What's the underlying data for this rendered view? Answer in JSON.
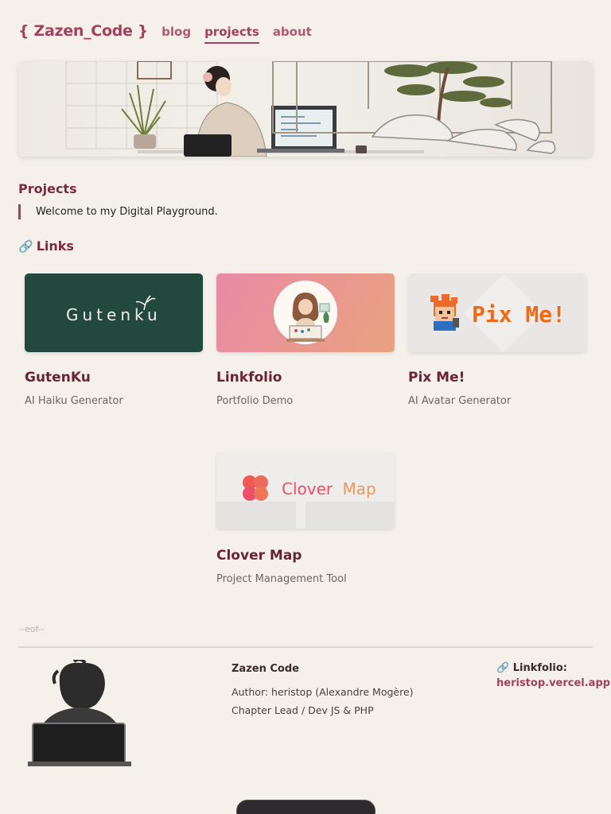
{
  "nav": {
    "logo": "{ Zazen_Code }",
    "links": [
      "blog",
      "projects",
      "about"
    ]
  },
  "projects": {
    "title": "Projects",
    "quote": "Welcome to my Digital Playground.",
    "links_title": "Links",
    "links_icon": "🔗"
  },
  "cards": [
    {
      "title": "GutenKu",
      "subtitle": "AI Haiku Generator",
      "thumb_text": "Gutenku"
    },
    {
      "title": "Linkfolio",
      "subtitle": "Portfolio Demo"
    },
    {
      "title": "Pix Me!",
      "subtitle": "AI Avatar Generator",
      "thumb_text": "Pix Me!"
    },
    {
      "title": "Clover Map",
      "subtitle": "Project Management Tool",
      "thumb_text_a": "Clover",
      "thumb_text_b": "Map"
    }
  ],
  "footer": {
    "eof": "--eof--",
    "name": "Zazen Code",
    "author": "Author: heristop (Alexandre Mogère)",
    "role": "Chapter Lead / Dev JS & PHP",
    "link_icon": "🔗",
    "link_label": "Linkfolio:",
    "link_url": "heristop.vercel.app"
  },
  "colors": {
    "accent": "#a3405d",
    "background": "#f5f0ea"
  }
}
